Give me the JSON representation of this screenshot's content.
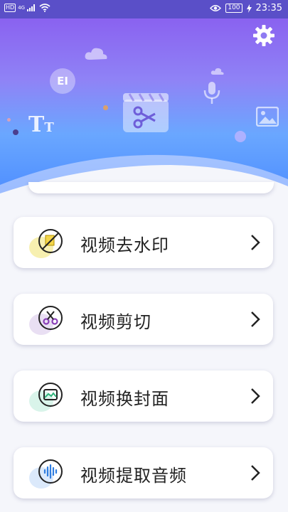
{
  "status_bar": {
    "hd": "HD",
    "net": "4G",
    "battery": "100",
    "time": "23:35"
  },
  "header": {
    "deco_text_1": "EI",
    "deco_text_2": "T",
    "deco_text_3": "T"
  },
  "menu": {
    "items": [
      {
        "label": "视频去水印",
        "icon": "no-watermark-icon",
        "accent": "#f7f0b0"
      },
      {
        "label": "视频剪切",
        "icon": "scissors-icon",
        "accent": "#e9dff3"
      },
      {
        "label": "视频换封面",
        "icon": "image-frame-icon",
        "accent": "#d9f4ea"
      },
      {
        "label": "视频提取音频",
        "icon": "audio-wave-icon",
        "accent": "#dbe9fb"
      }
    ]
  },
  "colors": {
    "header_top": "#8a62f0",
    "header_bottom": "#4d8dff",
    "card_bg": "#ffffff"
  }
}
